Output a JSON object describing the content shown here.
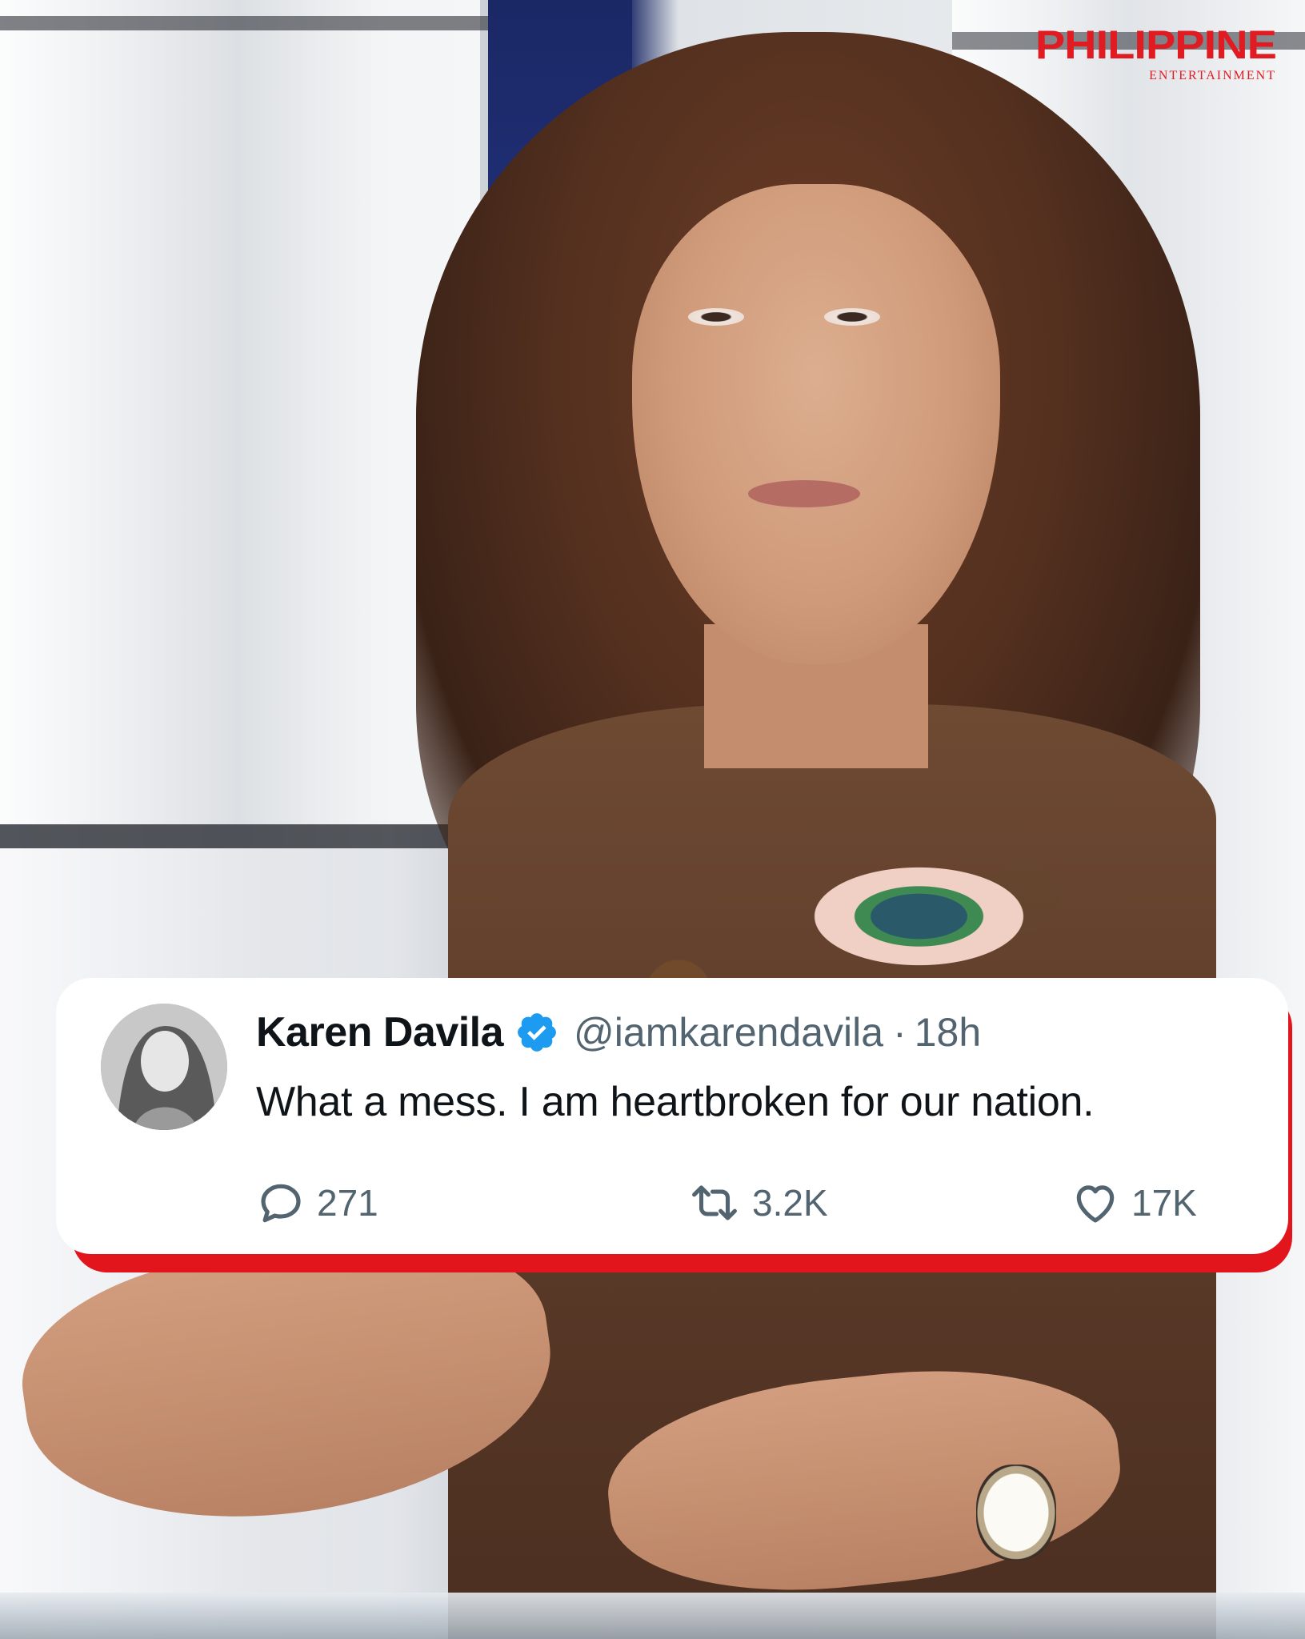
{
  "brand": {
    "name": "PHILIPPINE",
    "tagline": "ENTERTAINMENT",
    "color": "#e11b22"
  },
  "tweet": {
    "display_name": "Karen Davila",
    "verified": true,
    "handle": "@iamkarendavila",
    "separator": "·",
    "time": "18h",
    "text": "What a mess. I am heartbroken for our nation.",
    "actions": {
      "replies": {
        "icon": "reply-icon",
        "count": "271"
      },
      "retweets": {
        "icon": "retweet-icon",
        "count": "3.2K"
      },
      "likes": {
        "icon": "heart-icon",
        "count": "17K"
      }
    },
    "card_accent": "#e3151c",
    "verified_color": "#1d9bf0"
  }
}
